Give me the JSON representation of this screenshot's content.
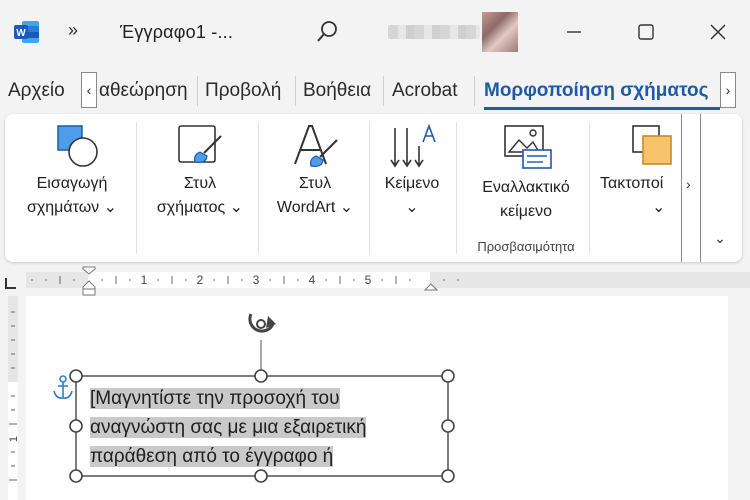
{
  "titlebar": {
    "overflow": "»",
    "doc_title": "Έγγραφο1  -..."
  },
  "tabs": {
    "left_arrow": "‹",
    "right_arrow": "›",
    "items": [
      "Αρχείο",
      "αθεώρηση",
      "Προβολή",
      "Βοήθεια",
      "Acrobat",
      "Μορφοποίηση σχήματος"
    ]
  },
  "ribbon": {
    "insert_shapes": [
      "Εισαγωγή",
      "σχημάτων ⌄"
    ],
    "shape_style": [
      "Στυλ",
      "σχήματος ⌄"
    ],
    "wordart_style": [
      "Στυλ",
      "WordArt ⌄"
    ],
    "text": [
      "Κείμενο",
      "⌄"
    ],
    "alt_text": [
      "Εναλλακτικό",
      "κείμενο"
    ],
    "arrange": [
      "Τακτοποί",
      "⌄"
    ],
    "group_accessibility": "Προσβασιμότητα",
    "scroll_right": "›",
    "expand": "⌄"
  },
  "ruler": {
    "numbers": [
      "1",
      "2",
      "3",
      "4",
      "5"
    ],
    "vertical_number": "1"
  },
  "document": {
    "shape_text_lines": [
      "[Μαγνητίστε την προσοχή του",
      "αναγνώστη σας με μια εξαιρετική",
      "παράθεση από το έγγραφο ή"
    ]
  },
  "colors": {
    "accent": "#1d5aa8",
    "word_blue": "#185abd",
    "selection": "#c9c9c9"
  }
}
